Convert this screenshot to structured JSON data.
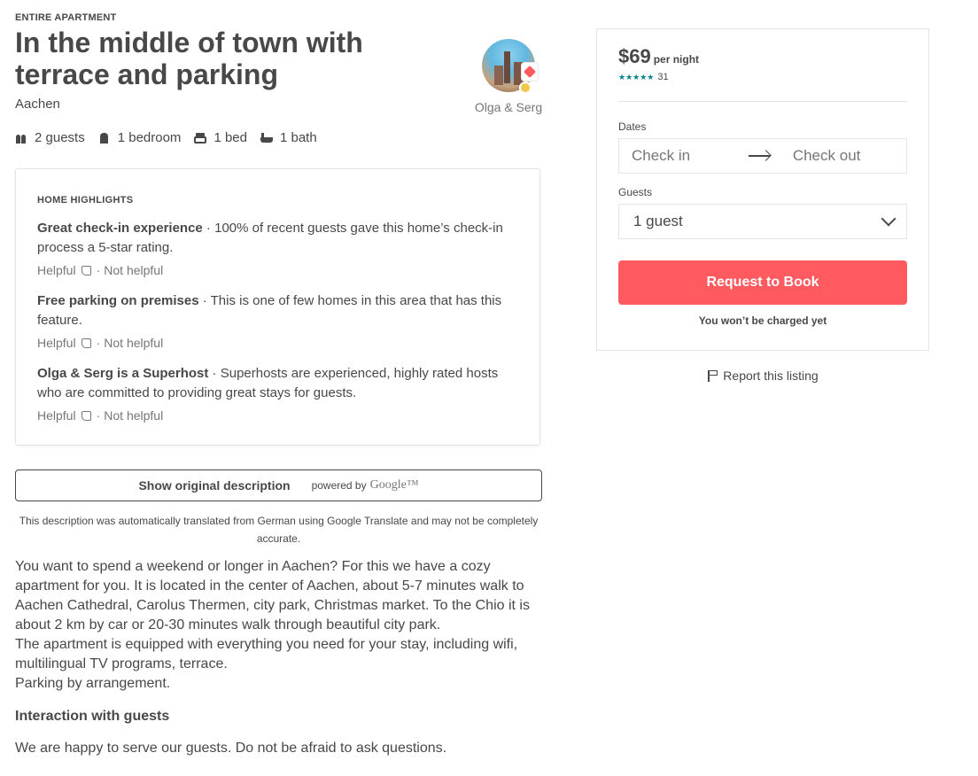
{
  "listing": {
    "kicker": "ENTIRE APARTMENT",
    "title": "In the middle of town with terrace and parking",
    "city": "Aachen"
  },
  "host": {
    "name": "Olga & Serg"
  },
  "specs": [
    {
      "label": "2 guests",
      "icon": "guests-icon"
    },
    {
      "label": "1 bedroom",
      "icon": "bedroom-icon"
    },
    {
      "label": "1 bed",
      "icon": "bed-icon"
    },
    {
      "label": "1 bath",
      "icon": "bath-icon"
    }
  ],
  "highlights": {
    "label": "HOME HIGHLIGHTS",
    "items": [
      {
        "title": "Great check-in experience",
        "text": " · 100% of recent guests gave this home’s check-in process a 5-star rating.",
        "helpful": "Helpful",
        "separator": "·",
        "not_helpful": "Not helpful"
      },
      {
        "title": "Free parking on premises",
        "text": " · This is one of few homes in this area that has this feature.",
        "helpful": "Helpful",
        "separator": "·",
        "not_helpful": "Not helpful"
      },
      {
        "title": "Olga & Serg is a Superhost",
        "text": " · Superhosts are experienced, highly rated hosts who are committed to providing great stays for guests.",
        "helpful": "Helpful",
        "separator": "·",
        "not_helpful": "Not helpful"
      }
    ]
  },
  "translation": {
    "button_label": "Show original description",
    "powered_by": "powered by",
    "google": "Google™",
    "note": "This description was automatically translated from German using Google Translate and may not be completely accurate."
  },
  "description": "You want to spend a weekend or longer in Aachen? For this we have a cozy apartment for you. It is located in the center of Aachen, about 5-7 minutes walk to Aachen Cathedral, Carolus Thermen, city park, Christmas market. To the Chio it is about 2 km by car or 20-30 minutes walk through beautiful city park.\nThe apartment is equipped with everything you need for your stay, including wifi, multilingual TV programs, terrace.\nParking by arrangement.",
  "interaction": {
    "title": "Interaction with guests",
    "text": "We are happy to serve our guests. Do not be afraid to ask questions."
  },
  "booking": {
    "price": "$69",
    "per_night": "per night",
    "stars": "★★★★★",
    "reviews": "31",
    "dates_label": "Dates",
    "check_in": "Check in",
    "check_out": "Check out",
    "guests_label": "Guests",
    "guests_value": "1 guest",
    "request_button": "Request to Book",
    "charge_note": "You won’t be charged yet"
  },
  "report": {
    "label": "Report this listing"
  },
  "colors": {
    "brand": "#ff5a5f",
    "text": "#484848",
    "muted": "#767676",
    "stars": "#008489"
  }
}
